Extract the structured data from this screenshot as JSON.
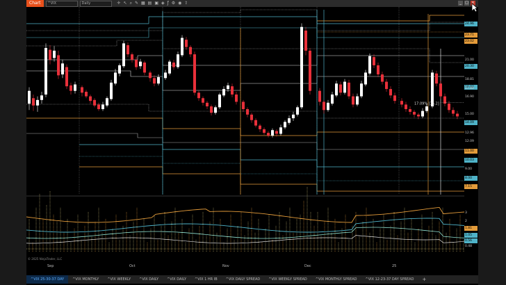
{
  "toolbar": {
    "chart_tab_label": "Chart",
    "instrument_value": "^VIX",
    "interval_value": "Daily",
    "icons": [
      "crosshair-icon",
      "pointer-icon",
      "zoom-icon",
      "draw-icon",
      "grid-icon",
      "template-icon",
      "data-box-icon",
      "strategy-icon",
      "indicator-icon",
      "properties-icon",
      "snapshot-icon",
      "share-icon"
    ]
  },
  "y_axis_labels": [
    {
      "value": "24.96",
      "color": "#4fb3c8",
      "y": 24.96
    },
    {
      "value": "23.71",
      "color": "#e39b3a",
      "y": 23.71
    },
    {
      "value": "23.02",
      "color": "#e39b3a",
      "y": 23.02
    },
    {
      "value": "21.00",
      "color": "",
      "y": 21.0
    },
    {
      "value": "20.30",
      "color": "#4fb3c8",
      "y": 20.3
    },
    {
      "value": "18.81",
      "color": "",
      "y": 18.81
    },
    {
      "value": "18.02",
      "color": "#4fb3c8",
      "y": 18.02
    },
    {
      "value": "17.84",
      "color": "",
      "y": 17.84
    },
    {
      "value": "16.90",
      "color": "",
      "y": 16.9
    },
    {
      "value": "15.00",
      "color": "",
      "y": 15.0
    },
    {
      "value": "14.09",
      "color": "#4fb3c8",
      "y": 14.09
    },
    {
      "value": "12.96",
      "color": "",
      "y": 12.96
    },
    {
      "value": "12.09",
      "color": "",
      "y": 12.09
    },
    {
      "value": "11.00",
      "color": "#e39b3a",
      "y": 11.0
    },
    {
      "value": "10.03",
      "color": "#4fb3c8",
      "y": 10.03
    },
    {
      "value": "9.00",
      "color": "",
      "y": 9.0
    },
    {
      "value": "8.00",
      "color": "#4fb3c8",
      "y": 8.0
    },
    {
      "value": "7.15",
      "color": "#e39b3a",
      "y": 7.15
    }
  ],
  "indicator_labels": [
    {
      "value": "3",
      "color": ""
    },
    {
      "value": "2",
      "color": ""
    },
    {
      "value": "1.81",
      "color": "#e39b3a"
    },
    {
      "value": "1.05",
      "color": "#4fb3c8"
    },
    {
      "value": "0.56",
      "color": "#4fb3c8"
    },
    {
      "value": "0.48",
      "color": ""
    }
  ],
  "price_annotation": "17.09% [15.2]",
  "x_axis_labels": [
    "Sep",
    "Oct",
    "Nov",
    "Dec",
    "25"
  ],
  "copyright": "© 2025 NinjaTrader, LLC",
  "tabs": [
    {
      "label": "^VIX 25-30-37 DAY",
      "active": true
    },
    {
      "label": "^VIX MONTHLY",
      "active": false
    },
    {
      "label": "^VIX WEEKLY",
      "active": false
    },
    {
      "label": "^VIX DAILY",
      "active": false
    },
    {
      "label": "^VIX DAILY",
      "active": false
    },
    {
      "label": "^VIX 1 HR IB",
      "active": false
    },
    {
      "label": "^VIX DAILY SPREAD",
      "active": false
    },
    {
      "label": "^VIX WEEKLY SPREAD",
      "active": false
    },
    {
      "label": "^VIX MONTHLY SPREAD",
      "active": false
    },
    {
      "label": "^VIX 12-23-37 DAY SPREAD",
      "active": false
    }
  ],
  "add_tab_label": "+",
  "colors": {
    "up": "#ffffff",
    "down": "#e8303a",
    "orange": "#e39b3a",
    "cyan": "#4fb3c8",
    "grey": "#aaaaaa"
  }
}
